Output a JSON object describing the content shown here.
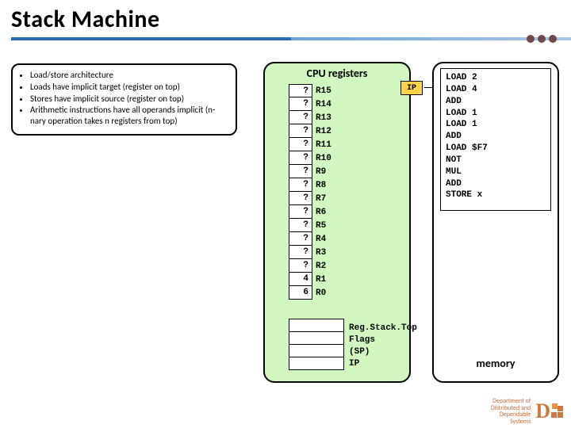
{
  "title": "Stack Machine",
  "bullets": [
    "Load/store architecture",
    "Loads have implicit target (register on top)",
    "Stores have implicit source (register on top)",
    "Arithmetic instructions have all operands implicit (n-nary operation takes n registers from top)"
  ],
  "cpu": {
    "title": "CPU registers",
    "regs": [
      {
        "name": "R15",
        "val": "?"
      },
      {
        "name": "R14",
        "val": "?"
      },
      {
        "name": "R13",
        "val": "?"
      },
      {
        "name": "R12",
        "val": "?"
      },
      {
        "name": "R11",
        "val": "?"
      },
      {
        "name": "R10",
        "val": "?"
      },
      {
        "name": "R9",
        "val": "?"
      },
      {
        "name": "R8",
        "val": "?"
      },
      {
        "name": "R7",
        "val": "?"
      },
      {
        "name": "R6",
        "val": "?"
      },
      {
        "name": "R5",
        "val": "?"
      },
      {
        "name": "R4",
        "val": "?"
      },
      {
        "name": "R3",
        "val": "?"
      },
      {
        "name": "R2",
        "val": "?"
      },
      {
        "name": "R1",
        "val": "4"
      },
      {
        "name": "R0",
        "val": "6"
      }
    ],
    "meta": [
      "Reg.Stack.Top",
      "Flags",
      "(SP)",
      "IP"
    ]
  },
  "ip_label": "IP",
  "memory": {
    "label": "memory",
    "code": "LOAD 2\nLOAD 4\nADD\nLOAD 1\nLOAD 1\nADD\nLOAD $F7\nNOT\nMUL\nADD\nSTORE x"
  },
  "footer": {
    "line1": "Department of",
    "line2": "Distributed and",
    "line3": "Dependable",
    "line4": "Systems"
  }
}
